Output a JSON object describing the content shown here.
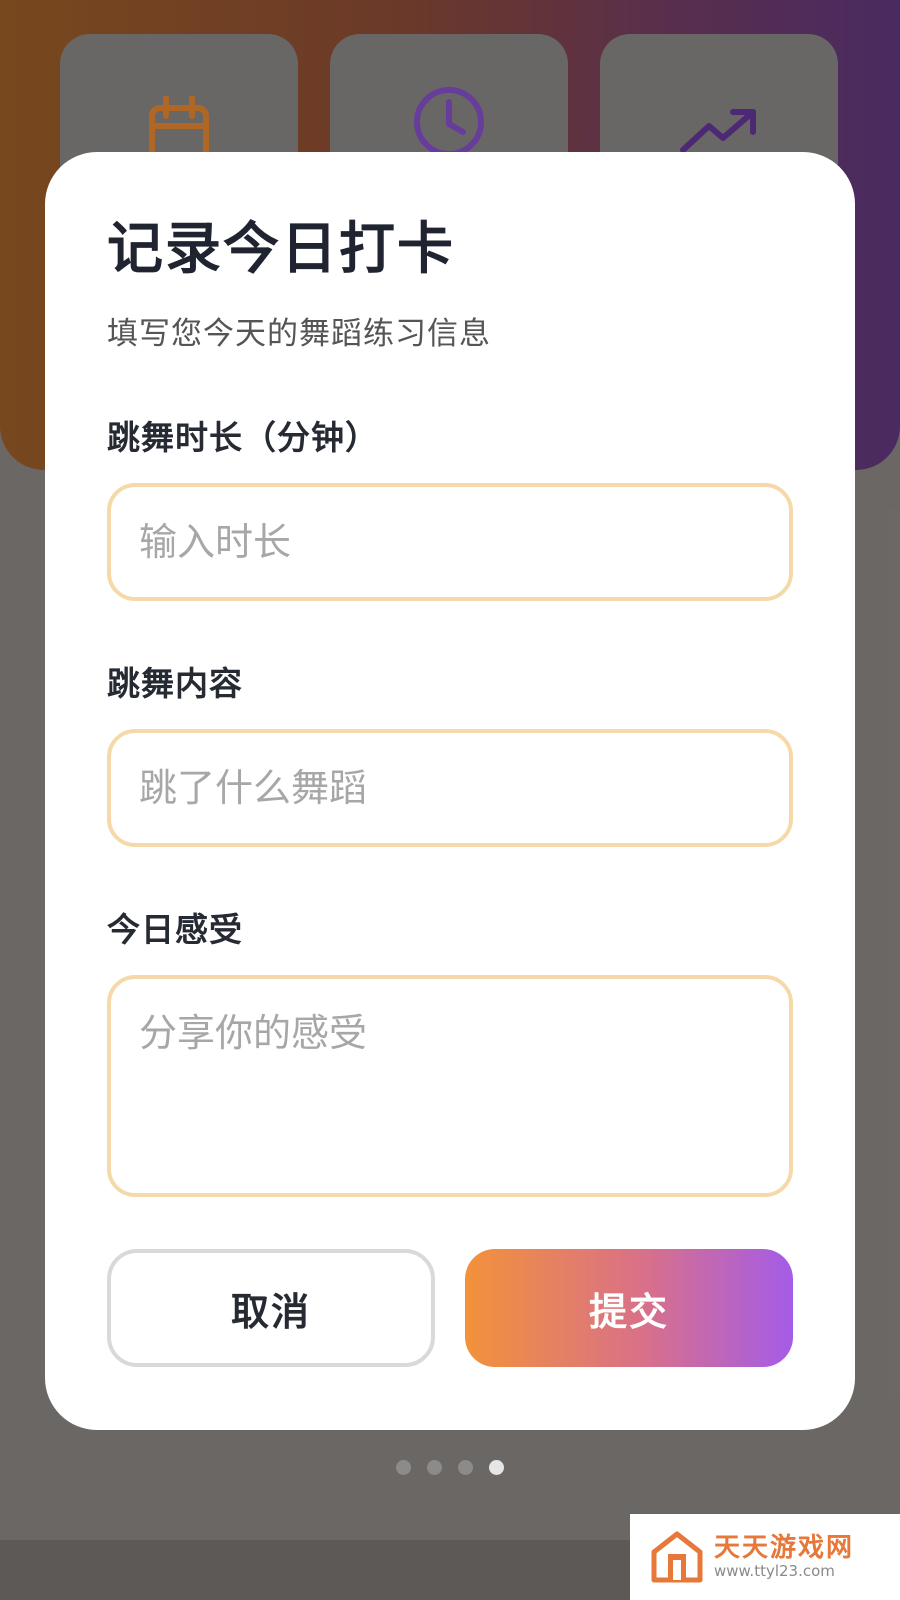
{
  "dialog": {
    "title": "记录今日打卡",
    "subtitle": "填写您今天的舞蹈练习信息",
    "fields": [
      {
        "label": "跳舞时长（分钟）",
        "placeholder": "输入时长",
        "value": ""
      },
      {
        "label": "跳舞内容",
        "placeholder": "跳了什么舞蹈",
        "value": ""
      },
      {
        "label": "今日感受",
        "placeholder": "分享你的感受",
        "value": ""
      }
    ],
    "cancel_label": "取消",
    "submit_label": "提交"
  },
  "background": {
    "cards": [
      {
        "icon": "calendar-icon",
        "color": "#f08c28"
      },
      {
        "icon": "clock-icon",
        "color": "#8a4fd6"
      },
      {
        "icon": "trending-up-icon",
        "color": "#6a2fa6"
      }
    ]
  },
  "pager": {
    "count": 4,
    "active_index": 3
  },
  "watermark": {
    "name": "天天游戏网",
    "url": "www.ttyl23.com",
    "logo": "house-logo-icon"
  },
  "colors": {
    "input_border": "#f6d9a9",
    "submit_gradient_start": "#f2923a",
    "submit_gradient_end": "#a45ce8"
  }
}
